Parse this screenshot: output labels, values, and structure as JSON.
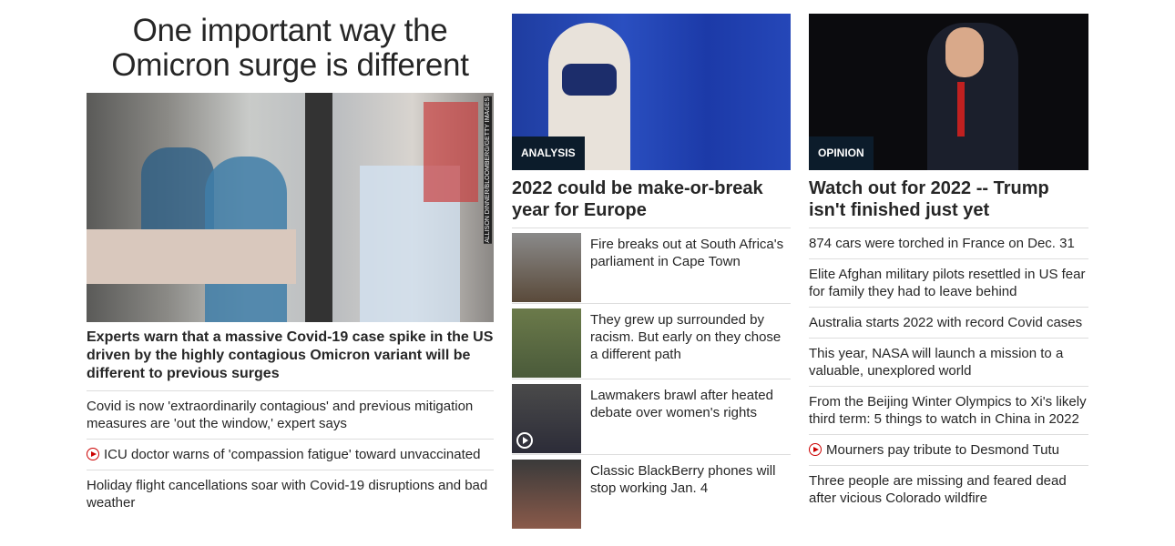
{
  "col1": {
    "headline": "One important way the Omicron surge is different",
    "photo_credit": "ALLISON DINNER/BLOOMBERG/GETTY IMAGES",
    "lead": "Experts warn that a massive Covid-19 case spike in the US driven by the highly contagious Omicron variant will be different to previous surges",
    "items": [
      {
        "text": "Covid is now 'extraordinarily contagious' and previous mitigation measures are 'out the window,' expert says",
        "video": false
      },
      {
        "text": "ICU doctor warns of 'compassion fatigue' toward unvaccinated",
        "video": true
      },
      {
        "text": "Holiday flight cancellations soar with Covid-19 disruptions and bad weather",
        "video": false
      }
    ]
  },
  "col2": {
    "tag": "ANALYSIS",
    "headline": "2022 could be make-or-break year for Europe",
    "items": [
      {
        "text": "Fire breaks out at South Africa's parliament in Cape Town"
      },
      {
        "text": "They grew up surrounded by racism. But early on they chose a different path"
      },
      {
        "text": "Lawmakers brawl after heated debate over women's rights",
        "video": true
      },
      {
        "text": "Classic BlackBerry phones will stop working Jan. 4"
      }
    ]
  },
  "col3": {
    "tag": "OPINION",
    "headline": "Watch out for 2022 -- Trump isn't finished just yet",
    "items": [
      {
        "text": "874 cars were torched in France on Dec. 31"
      },
      {
        "text": "Elite Afghan military pilots resettled in US fear for family they had to leave behind"
      },
      {
        "text": "Australia starts 2022 with record Covid cases"
      },
      {
        "text": "This year, NASA will launch a mission to a valuable, unexplored world"
      },
      {
        "text": "From the Beijing Winter Olympics to Xi's likely third term: 5 things to watch in China in 2022"
      },
      {
        "text": "Mourners pay tribute to Desmond Tutu",
        "video": true
      },
      {
        "text": "Three people are missing and feared dead after vicious Colorado wildfire"
      }
    ]
  },
  "colors": {
    "tag_bg": "#0c1c2b",
    "video_icon": "#cc0000",
    "text": "#262626"
  }
}
